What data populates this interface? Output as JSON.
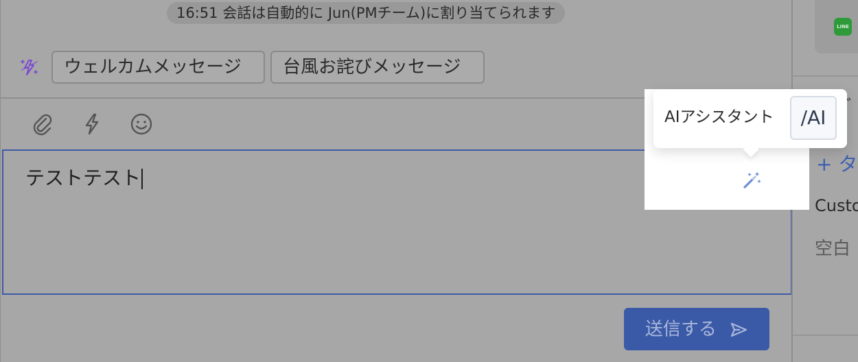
{
  "system_message": "16:51 会話は自動的に Jun(PMチーム)に割り当てられます",
  "templates": [
    {
      "label": "ウェルカムメッセージ"
    },
    {
      "label": "台風お詫びメッセージ"
    }
  ],
  "toolbar": {
    "icons": [
      "paperclip-icon",
      "bolt-icon",
      "smiley-icon"
    ]
  },
  "editor": {
    "value": "テストテスト"
  },
  "send_button": {
    "label": "送信する"
  },
  "tooltip": {
    "label": "AIアシスタント",
    "shortcut": "/AI"
  },
  "sidebar": {
    "channel_icon": "LINE",
    "mark": "゛",
    "add_tag": "+ タ",
    "custom_label": "Custo",
    "empty_label": "空白"
  },
  "colors": {
    "accent": "#3a5aa8",
    "sparkle": "#7b4bd1",
    "line_green": "#2f9a3a"
  }
}
